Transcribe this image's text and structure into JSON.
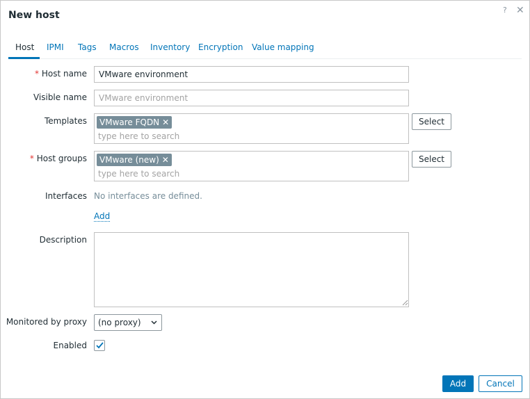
{
  "dialog": {
    "title": "New host",
    "help_symbol": "?",
    "close_symbol": "✕"
  },
  "tabs": [
    {
      "label": "Host",
      "active": true
    },
    {
      "label": "IPMI"
    },
    {
      "label": "Tags"
    },
    {
      "label": "Macros"
    },
    {
      "label": "Inventory"
    },
    {
      "label": "Encryption"
    },
    {
      "label": "Value mapping"
    }
  ],
  "form": {
    "required_mark": "*",
    "host_name": {
      "label": "Host name",
      "value": "VMware environment"
    },
    "visible_name": {
      "label": "Visible name",
      "value": "",
      "placeholder": "VMware environment"
    },
    "templates": {
      "label": "Templates",
      "chips": [
        "VMware FQDN"
      ],
      "placeholder": "type here to search",
      "select_label": "Select"
    },
    "host_groups": {
      "label": "Host groups",
      "chips": [
        "VMware (new)"
      ],
      "placeholder": "type here to search",
      "select_label": "Select"
    },
    "interfaces": {
      "label": "Interfaces",
      "empty_text": "No interfaces are defined.",
      "add_label": "Add"
    },
    "description": {
      "label": "Description",
      "value": ""
    },
    "proxy": {
      "label": "Monitored by proxy",
      "selected": "(no proxy)"
    },
    "enabled": {
      "label": "Enabled",
      "checked": true
    }
  },
  "footer": {
    "add_label": "Add",
    "cancel_label": "Cancel"
  },
  "colors": {
    "accent": "#0275b8",
    "chip": "#768d99",
    "required": "#e33734"
  },
  "icons": {
    "help": "help-icon",
    "close": "close-icon",
    "chip_remove": "chip-remove-icon",
    "dropdown": "chevron-down-icon",
    "checkmark": "checkmark-icon"
  }
}
